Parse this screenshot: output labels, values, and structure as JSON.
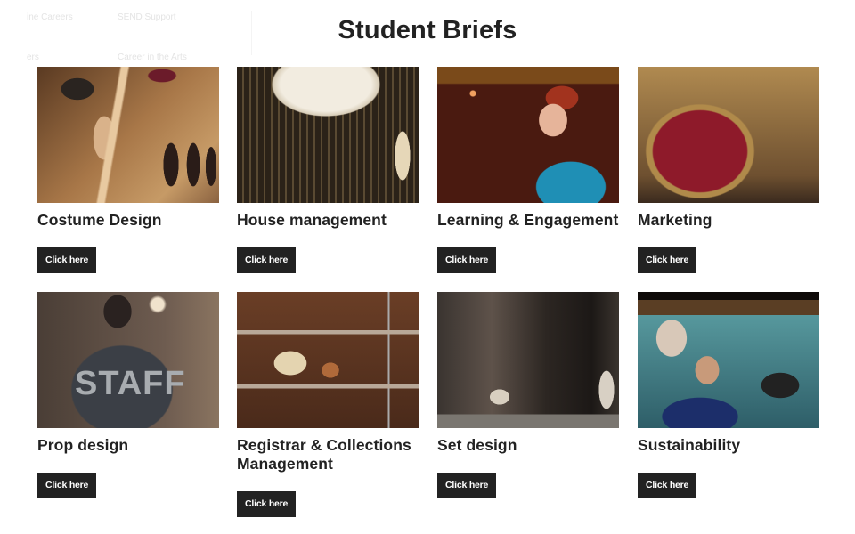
{
  "background_menu": {
    "items": [
      "ine Careers",
      "SEND Support",
      "ers",
      "Career in the Arts"
    ]
  },
  "page": {
    "title": "Student Briefs"
  },
  "cards": [
    {
      "title": "Costume Design",
      "button": "Click here",
      "image": "costume-design-photo"
    },
    {
      "title": "House management",
      "button": "Click here",
      "image": "chandelier-photo"
    },
    {
      "title": "Learning & Engagement",
      "button": "Click here",
      "image": "staff-member-photo"
    },
    {
      "title": "Marketing",
      "button": "Click here",
      "image": "theatre-proscenium-photo"
    },
    {
      "title": "Prop design",
      "button": "Click here",
      "image": "staff-tshirt-photo",
      "image_text": "STAFF"
    },
    {
      "title": "Registrar & Collections Management",
      "button": "Click here",
      "image": "collection-shelves-photo"
    },
    {
      "title": "Set design",
      "button": "Click here",
      "image": "stage-set-photo"
    },
    {
      "title": "Sustainability",
      "button": "Click here",
      "image": "performers-photo"
    }
  ]
}
